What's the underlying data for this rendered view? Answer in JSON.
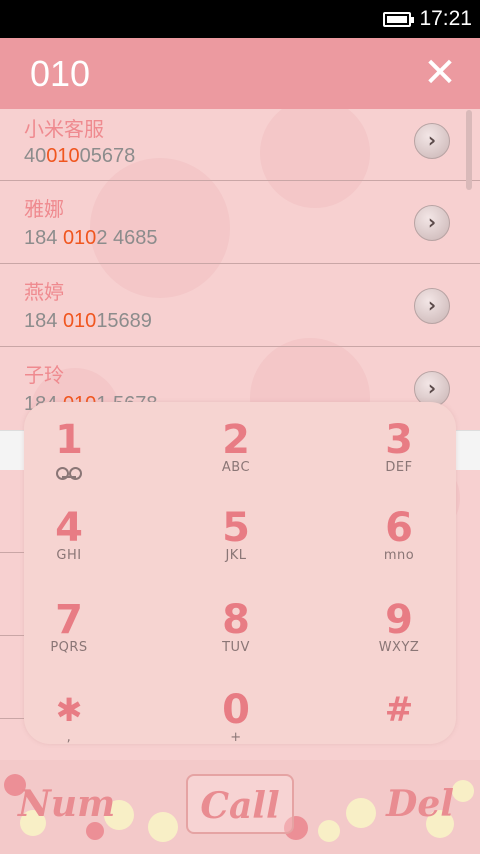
{
  "status": {
    "time": "17:21",
    "battery_icon": "battery-full-icon"
  },
  "header": {
    "query": "010",
    "close_icon": "close-icon",
    "close_glyph": "✕"
  },
  "contacts": [
    {
      "name": "小米客服",
      "number_before": "40",
      "number_match": "010",
      "number_after": "05678"
    },
    {
      "name": "雅娜",
      "number_before": "184 ",
      "number_match": "010",
      "number_after": "2 4685"
    },
    {
      "name": "燕婷",
      "number_before": "184 ",
      "number_match": "010",
      "number_after": "15689"
    },
    {
      "name": "子玲",
      "number_before": "184 ",
      "number_match": "010",
      "number_after": "1 5678"
    }
  ],
  "detail_glyph": "›",
  "dialpad": [
    {
      "digit": "1",
      "letters": "",
      "icon": "voicemail-icon"
    },
    {
      "digit": "2",
      "letters": "ABC"
    },
    {
      "digit": "3",
      "letters": "DEF"
    },
    {
      "digit": "4",
      "letters": "GHI"
    },
    {
      "digit": "5",
      "letters": "JKL"
    },
    {
      "digit": "6",
      "letters": "mno"
    },
    {
      "digit": "7",
      "letters": "PQRS"
    },
    {
      "digit": "8",
      "letters": "TUV"
    },
    {
      "digit": "9",
      "letters": "WXYZ"
    },
    {
      "digit": "✱",
      "letters": ","
    },
    {
      "digit": "0",
      "letters": "+"
    },
    {
      "digit": "#",
      "letters": ""
    }
  ],
  "bottom": {
    "num_label": "Num",
    "call_label": "Call",
    "del_label": "Del"
  },
  "colors": {
    "header": "#ec9aa0",
    "highlight": "#f0561f",
    "contact_name": "#ef8a8f",
    "digit": "#e87c84",
    "background": "#f7d0d0"
  }
}
